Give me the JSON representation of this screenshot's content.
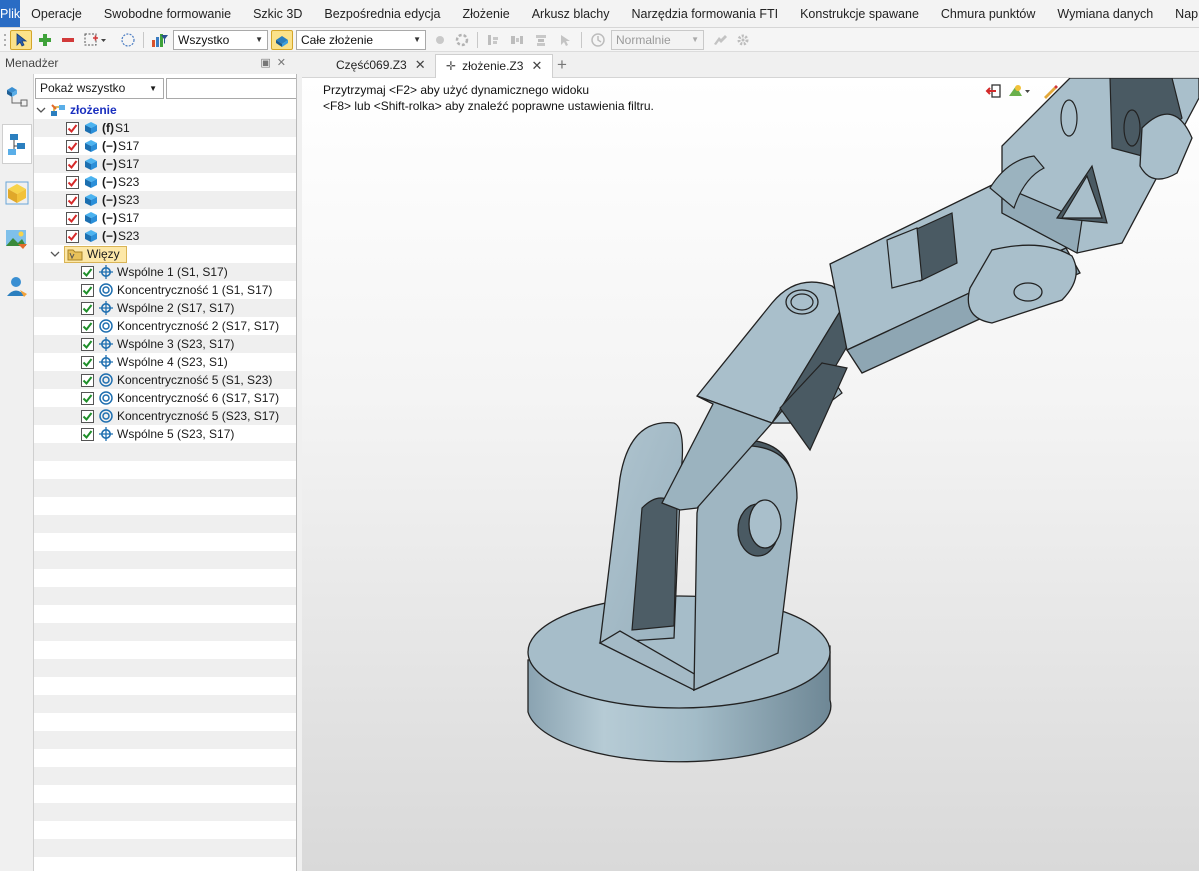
{
  "menu": {
    "file_label": "Plik",
    "items": [
      "Operacje",
      "Swobodne formowanie",
      "Szkic 3D",
      "Bezpośrednia edycja",
      "Złożenie",
      "Arkusz blachy",
      "Narzędzia formowania FTI",
      "Konstrukcje spawane",
      "Chmura punktów",
      "Wymiana danych",
      "Naprawa"
    ]
  },
  "toolbar": {
    "filter_value": "Wszystko",
    "scope_value": "Całe złożenie",
    "mode_value": "Normalnie"
  },
  "manager": {
    "title": "Menadżer",
    "filter_value": "Pokaż wszystko",
    "search_value": ""
  },
  "tree": {
    "root_label": "złożenie",
    "parts": [
      {
        "prefix": "(f)",
        "label": "S1"
      },
      {
        "prefix": "(−)",
        "label": "S17"
      },
      {
        "prefix": "(−)",
        "label": "S17"
      },
      {
        "prefix": "(−)",
        "label": "S23"
      },
      {
        "prefix": "(−)",
        "label": "S23"
      },
      {
        "prefix": "(−)",
        "label": "S17"
      },
      {
        "prefix": "(−)",
        "label": "S23"
      }
    ],
    "constraints_folder": "Więzy",
    "constraints": [
      {
        "type": "coincident",
        "label": "Wspólne 1 (S1, S17)"
      },
      {
        "type": "concentric",
        "label": "Koncentryczność 1 (S1, S17)"
      },
      {
        "type": "coincident",
        "label": "Wspólne 2 (S17, S17)"
      },
      {
        "type": "concentric",
        "label": "Koncentryczność 2 (S17, S17)"
      },
      {
        "type": "coincident",
        "label": "Wspólne 3 (S23, S17)"
      },
      {
        "type": "coincident",
        "label": "Wspólne 4 (S23, S1)"
      },
      {
        "type": "concentric",
        "label": "Koncentryczność 5 (S1, S23)"
      },
      {
        "type": "concentric",
        "label": "Koncentryczność 6 (S17, S17)"
      },
      {
        "type": "concentric",
        "label": "Koncentryczność 5 (S23, S17)"
      },
      {
        "type": "coincident",
        "label": "Wspólne 5 (S23, S17)"
      }
    ]
  },
  "tabs": [
    {
      "label": "Część069.Z3",
      "active": false,
      "modified": false
    },
    {
      "label": "złożenie.Z3",
      "active": true,
      "modified": true
    }
  ],
  "viewport": {
    "hint_line1": "Przytrzymaj <F2> aby użyć dynamicznego widoku",
    "hint_line2": "<F8> lub <Shift-rolka> aby znaleźć poprawne ustawienia filtru."
  },
  "colors": {
    "accent": "#2a6cc4",
    "model_light": "#a9bfcb",
    "model_mid": "#8aa3b1",
    "model_dark": "#4b5b64",
    "root_text": "#1a2fbf",
    "selection": "#fde8a8"
  },
  "icons": {
    "part": "cube-icon",
    "coincident": "crosshair-icon",
    "concentric": "concentric-circles-icon",
    "folder": "folder-icon"
  }
}
